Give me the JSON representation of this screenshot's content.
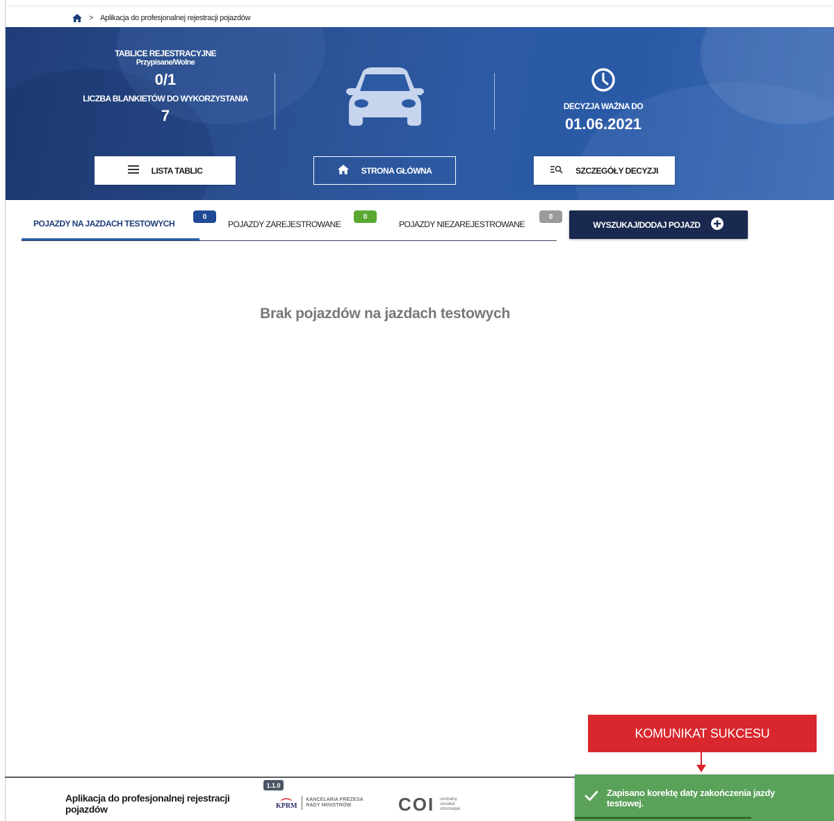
{
  "breadcrumb": {
    "home_icon": "home-icon",
    "separator": ">",
    "current": "Aplikacja do profesjonalnej rejestracji pojazdów"
  },
  "hero": {
    "plates_title": "TABLICE REJESTRACYJNE",
    "plates_subtitle": "Przypisane/Wolne",
    "plates_value": "0/1",
    "blanks_label": "LICZBA BLANKIETÓW DO WYKORZYSTANIA",
    "blanks_value": "7",
    "decision_label": "DECYZJA WAŻNA DO",
    "decision_value": "01.06.2021",
    "buttons": {
      "plates_list": "LISTA TABLIC",
      "home": "STRONA GŁÓWNA",
      "decision_details": "SZCZEGÓŁY DECYZJI"
    }
  },
  "tabs": [
    {
      "label": "POJAZDY NA JAZDACH TESTOWYCH",
      "count": "0",
      "active": true,
      "badge_color": "#1f4a95"
    },
    {
      "label": "POJAZDY ZAREJESTROWANE",
      "count": "0",
      "active": false,
      "badge_color": "#5aa831"
    },
    {
      "label": "POJAZDY NIEZAREJESTROWANE",
      "count": "0",
      "active": false,
      "badge_color": "#9a9a9a"
    }
  ],
  "search_button": {
    "label": "WYSZUKAJ/DODAJ POJAZD",
    "icon": "plus-circle-icon"
  },
  "empty_message": "Brak pojazdów na jazdach testowych",
  "callout": {
    "text": "KOMUNIKAT SUKCESU",
    "color": "#d9272e"
  },
  "footer": {
    "app_title": "Aplikacja do profesjonalnej rejestracji pojazdów",
    "version": "1.1.0",
    "kprm_abbr": "KPRM",
    "kprm_line1": "KANCELARIA PREZESA",
    "kprm_line2": "RADY MINISTRÓW",
    "coi_abbr": "COI",
    "coi_line1": "centralny",
    "coi_line2": "ośrodek",
    "coi_line3": "informatyki"
  },
  "toast": {
    "message": "Zapisano korektę daty zakończenia jazdy testowej.",
    "icon": "check-icon",
    "color": "#5aa15a",
    "progress": 0.68
  }
}
